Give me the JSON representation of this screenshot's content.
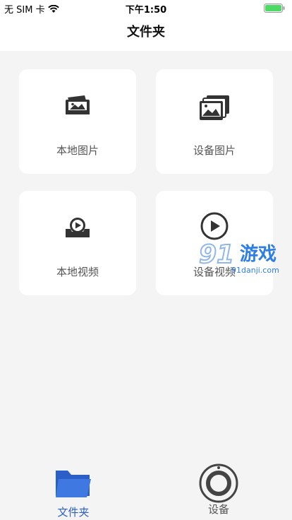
{
  "status_bar": {
    "carrier": "无 SIM 卡",
    "time": "下午1:50",
    "battery_color": "#4cd964"
  },
  "nav": {
    "title": "文件夹"
  },
  "cards": [
    {
      "label": "本地图片",
      "icon": "local-photo-icon"
    },
    {
      "label": "设备图片",
      "icon": "device-photos-icon"
    },
    {
      "label": "本地视频",
      "icon": "local-video-icon"
    },
    {
      "label": "设备视频",
      "icon": "device-video-icon"
    }
  ],
  "tabs": [
    {
      "label": "文件夹",
      "icon": "folder-icon",
      "active": true,
      "color": "#2b5fc7"
    },
    {
      "label": "设备",
      "icon": "camera-lens-icon",
      "active": false,
      "color": "#555555"
    }
  ],
  "watermark": {
    "logo": "91游戏",
    "site": "91danji.com"
  }
}
